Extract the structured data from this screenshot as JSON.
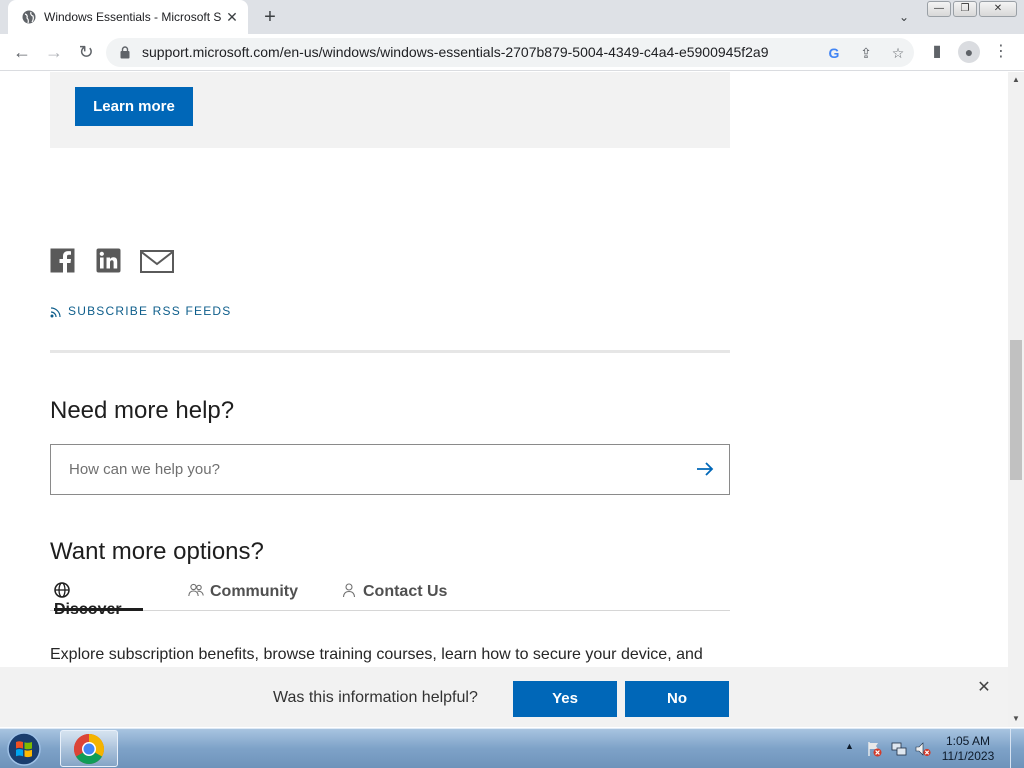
{
  "browser": {
    "tab_title": "Windows Essentials - Microsoft Support",
    "tab_close": "✕",
    "new_tab": "+",
    "tab_search": "⌄",
    "url": "support.microsoft.com/en-us/windows/windows-essentials-2707b879-5004-4349-c4a4-e5900945f2a9",
    "window_controls": {
      "minimize": "—",
      "restore": "❐",
      "close": "✕"
    },
    "nav": {
      "back": "←",
      "forward": "→",
      "reload": "↻"
    },
    "toolbar_icons": {
      "google": "G",
      "share": "⇪",
      "bookmark": "☆",
      "side_panel": "▮",
      "profile": "●",
      "menu": "⋮"
    }
  },
  "page": {
    "learn_more": "Learn more",
    "share_icons": [
      "facebook-icon",
      "linkedin-icon",
      "email-icon"
    ],
    "rss_label": "SUBSCRIBE RSS FEEDS",
    "help_heading": "Need more help?",
    "search_placeholder": "How can we help you?",
    "options_heading": "Want more options?",
    "tabs": [
      {
        "label": "Discover",
        "icon": "globe-icon",
        "active": true
      },
      {
        "label": "Community",
        "icon": "people-icon",
        "active": false
      },
      {
        "label": "Contact Us",
        "icon": "person-icon",
        "active": false
      }
    ],
    "explore_text": "Explore subscription benefits, browse training courses, learn how to secure your device, and"
  },
  "feedback": {
    "question": "Was this information helpful?",
    "yes": "Yes",
    "no": "No",
    "close": "✕"
  },
  "taskbar": {
    "time": "1:05 AM",
    "date": "11/1/2023",
    "tray_arrow": "▲"
  },
  "colors": {
    "accent": "#0067b8",
    "rss_link": "#0e5e8b",
    "promo_bg": "#f2f2f2"
  }
}
